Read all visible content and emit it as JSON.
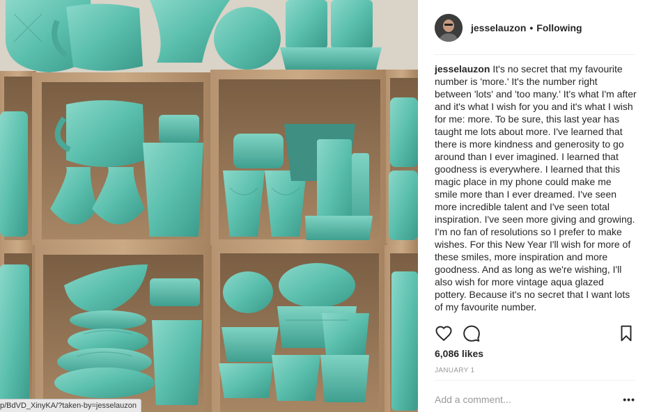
{
  "post": {
    "username": "jesselauzon",
    "separator": "•",
    "follow_status": "Following",
    "caption_user": "jesselauzon",
    "caption_text": "It's no secret that my favourite number is 'more.' It's the number right between 'lots' and 'too many.' It's what I'm after and it's what I wish for you and it's what I wish for me: more. To be sure, this last year has taught me lots about more. I've learned that there is more kindness and generosity to go around than I ever imagined. I learned that goodness is everywhere. I learned that this magic place in my phone could make me smile more than I ever dreamed. I've seen more incredible talent and I've seen total inspiration. I've seen more giving and growing. I'm no fan of resolutions so I prefer to make wishes. For this New Year I'll wish for more of these smiles, more inspiration and more goodness. And as long as we're wishing, I'll also wish for more vintage aqua glazed pottery. Because it's no secret that I want lots of my favourite number.",
    "likes": "6,086 likes",
    "date": "JANUARY 1",
    "comment_placeholder": "Add a comment...",
    "more_icon": "•••"
  },
  "browser": {
    "status_url": "p/BdVD_XinyKA/?taken-by=jesselauzon"
  },
  "icons": {
    "like": "heart-icon",
    "comment": "comment-bubble-icon",
    "save": "bookmark-icon",
    "options": "ellipsis-icon"
  },
  "colors": {
    "text": "#262626",
    "muted": "#999999",
    "divider": "#efefef",
    "pottery": "#5fbfae",
    "wood": "#a8876a"
  }
}
